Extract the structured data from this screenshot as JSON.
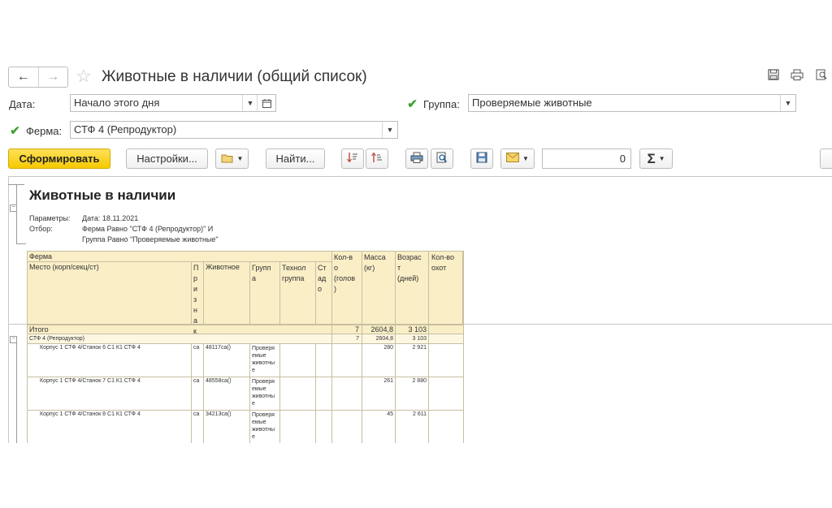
{
  "window": {
    "title": "Животные в наличии (общий список)",
    "back_icon": "←",
    "forward_icon": "→",
    "favorite_icon": "☆"
  },
  "filters": {
    "date_label": "Дата:",
    "date_value": "Начало этого дня",
    "group_label": "Группа:",
    "group_value": "Проверяемые животные",
    "farm_label": "Ферма:",
    "farm_value": "СТФ 4 (Репродуктор)"
  },
  "toolbar": {
    "generate": "Сформировать",
    "settings": "Настройки...",
    "find": "Найти...",
    "sum_value": "0",
    "sigma": "Σ"
  },
  "report": {
    "title": "Животные в наличии",
    "params_label": "Параметры:",
    "params_value": "Дата: 18.11.2021",
    "filter_label": "Отбор:",
    "filter_line1": "Ферма Равно \"СТФ 4 (Репродуктор)\" И",
    "filter_line2": "Группа Равно \"Проверяемые животные\"",
    "header": {
      "farm": "Ферма",
      "place": "Место (корп/секц/ст)",
      "sign_lines": [
        "П",
        "р",
        "и",
        "з",
        "н",
        "а",
        "к"
      ],
      "animal": "Животное",
      "group_lines": [
        "Групп",
        "а"
      ],
      "tech_lines": [
        "Технол",
        "группа"
      ],
      "herd_lines": [
        "Ст",
        "ад",
        "о"
      ],
      "count_lines": [
        "Кол-в",
        "о",
        "(голов",
        ")"
      ],
      "mass_lines": [
        "Масса",
        "(кг)"
      ],
      "age_lines": [
        "Возрас",
        "т",
        "(дней)"
      ],
      "hunts_lines": [
        "Кол-во",
        "охот"
      ]
    },
    "total": {
      "label": "Итого",
      "count": "7",
      "mass": "2604,8",
      "age": "3 103"
    },
    "farm_row": {
      "label": "СТФ 4 (Репродуктор)",
      "count": "7",
      "mass": "2604,8",
      "age": "3 103"
    },
    "rows": [
      {
        "place": "Корпус 1 СТФ 4/Станок 6 С1 К1 СТФ 4",
        "sign": "са",
        "animal": "48117са()",
        "group_lines": [
          "Проверя",
          "емые",
          "животны",
          "е"
        ],
        "mass": "280",
        "age": "2 921"
      },
      {
        "place": "Корпус 1 СТФ 4/Станок 7 С1 К1 СТФ 4",
        "sign": "са",
        "animal": "48558са()",
        "group_lines": [
          "Проверя",
          "емые",
          "животны",
          "е"
        ],
        "mass": "261",
        "age": "2 880"
      },
      {
        "place": "Корпус 1 СТФ 4/Станок 8 С1 К1 СТФ 4",
        "sign": "са",
        "animal": "34213са()",
        "group_lines": [
          "Проверя",
          "емые",
          "животны",
          "е"
        ],
        "mass": "45",
        "age": "2 611"
      }
    ]
  },
  "colors": {
    "primary_button": "#f5c900",
    "header_fill": "#f9eec6",
    "check": "#3fa535"
  }
}
